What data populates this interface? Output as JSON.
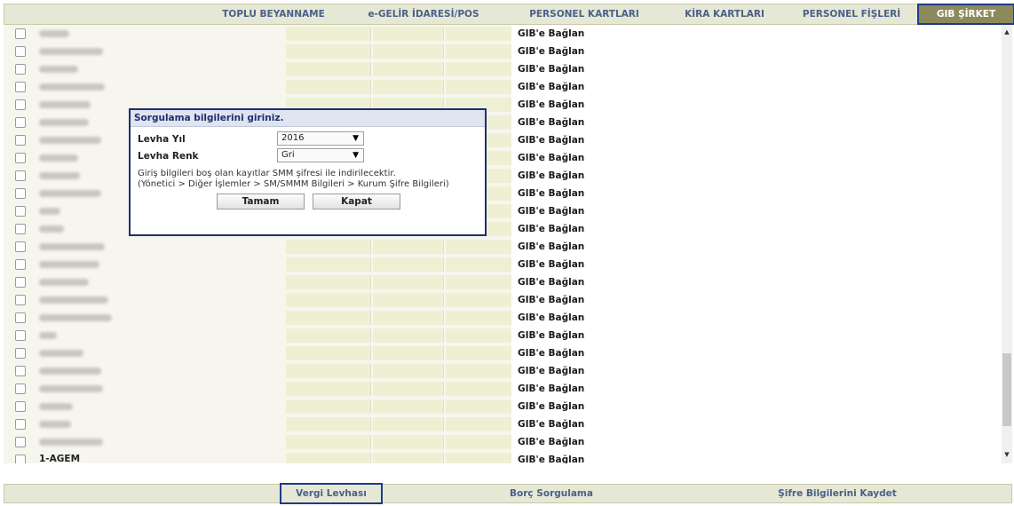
{
  "nav": {
    "tabs": [
      {
        "label": "TOPLU BEYANNAME",
        "active": false
      },
      {
        "label": "e-GELİR İDARESİ/POS",
        "active": false
      },
      {
        "label": "PERSONEL KARTLARI",
        "active": false
      },
      {
        "label": "KİRA KARTLARI",
        "active": false
      },
      {
        "label": "PERSONEL FİŞLERİ",
        "active": false
      },
      {
        "label": "GIB ŞİRKET",
        "active": true
      }
    ]
  },
  "grid": {
    "rows": [
      {
        "name": "",
        "action": "GIB'e Bağlan"
      },
      {
        "name": "",
        "action": "GIB'e Bağlan"
      },
      {
        "name": "",
        "action": "GIB'e Bağlan"
      },
      {
        "name": "",
        "action": "GIB'e Bağlan"
      },
      {
        "name": "",
        "action": "GIB'e Bağlan"
      },
      {
        "name": "",
        "action": "GIB'e Bağlan"
      },
      {
        "name": "",
        "action": "GIB'e Bağlan"
      },
      {
        "name": "",
        "action": "GIB'e Bağlan"
      },
      {
        "name": "",
        "action": "GIB'e Bağlan"
      },
      {
        "name": "",
        "action": "GIB'e Bağlan"
      },
      {
        "name": "",
        "action": "GIB'e Bağlan"
      },
      {
        "name": "",
        "action": "GIB'e Bağlan"
      },
      {
        "name": "",
        "action": "GIB'e Bağlan"
      },
      {
        "name": "",
        "action": "GIB'e Bağlan"
      },
      {
        "name": "",
        "action": "GIB'e Bağlan"
      },
      {
        "name": "",
        "action": "GIB'e Bağlan"
      },
      {
        "name": "",
        "action": "GIB'e Bağlan"
      },
      {
        "name": "",
        "action": "GIB'e Bağlan"
      },
      {
        "name": "",
        "action": "GIB'e Bağlan"
      },
      {
        "name": "",
        "action": "GIB'e Bağlan"
      },
      {
        "name": "",
        "action": "GIB'e Bağlan"
      },
      {
        "name": "",
        "action": "GIB'e Bağlan"
      },
      {
        "name": "",
        "action": "GIB'e Bağlan"
      },
      {
        "name": "",
        "action": "GIB'e Bağlan"
      },
      {
        "name": "1-AGEM",
        "action": "GIB'e Bağlan"
      }
    ]
  },
  "dialog": {
    "title": "Sorgulama bilgilerini giriniz.",
    "year_label": "Levha Yıl",
    "year_value": "2016",
    "color_label": "Levha Renk",
    "color_value": "Gri",
    "info_line1": "Giriş bilgileri boş olan kayıtlar SMM şifresi ile indirilecektir.",
    "info_line2": "(Yönetici > Diğer İşlemler > SM/SMMM Bilgileri > Kurum Şifre Bilgileri)",
    "ok_label": "Tamam",
    "close_label": "Kapat"
  },
  "bottom": {
    "buttons": [
      {
        "label": "Vergi Levhası",
        "active": true
      },
      {
        "label": "Borç Sorgulama",
        "active": false
      },
      {
        "label": "Şifre Bilgilerini Kaydet",
        "active": false
      }
    ]
  },
  "icons": {
    "scroll_up": "chevron-up-icon",
    "scroll_down": "chevron-down-icon",
    "dropdown": "caret-down-icon"
  },
  "colors": {
    "nav_bg": "#e6e8d6",
    "nav_text": "#4a6088",
    "active_tab_bg": "#8c8a5c",
    "active_border": "#1f3a8a",
    "dialog_border": "#1f2f6e",
    "input_cell": "#eef0d4"
  }
}
